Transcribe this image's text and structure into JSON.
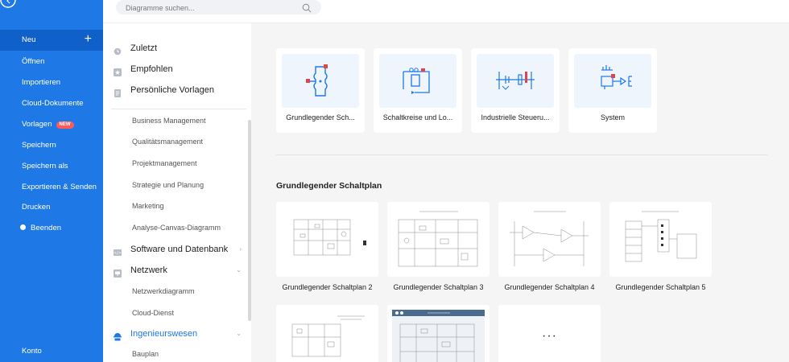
{
  "nav": {
    "items": [
      {
        "label": "Neu"
      },
      {
        "label": "Öffnen"
      },
      {
        "label": "Importieren"
      },
      {
        "label": "Cloud-Dokumente"
      },
      {
        "label": "Vorlagen",
        "badge": "NEW"
      },
      {
        "label": "Speichern"
      },
      {
        "label": "Speichern als"
      },
      {
        "label": "Exportieren & Senden"
      },
      {
        "label": "Drucken"
      },
      {
        "label": "Beenden"
      }
    ],
    "account": "Konto",
    "plus": "+"
  },
  "search": {
    "placeholder": "Diagramme suchen..."
  },
  "categories": {
    "recent": "Zuletzt",
    "recommended": "Empfohlen",
    "personal": "Persönliche Vorlagen",
    "subs": [
      "Business Management",
      "Qualitätsmanagement",
      "Projektmanagement",
      "Strategie und Planung",
      "Marketing",
      "Analyse-Canvas-Diagramm"
    ],
    "software": "Software und Datenbank",
    "network": "Netzwerk",
    "network_subs": [
      "Netzwerkdiagramm",
      "Cloud-Dienst"
    ],
    "engineering": "Ingenieurswesen",
    "engineering_subs": [
      "Bauplan"
    ]
  },
  "main": {
    "cat_cards": [
      {
        "label": "Grundlegender Sch..."
      },
      {
        "label": "Schaltkreise und Lo..."
      },
      {
        "label": "Industrielle Steueru..."
      },
      {
        "label": "System"
      }
    ],
    "section_title": "Grundlegender Schaltplan",
    "templates": [
      {
        "label": "Grundlegender Schaltplan 2"
      },
      {
        "label": "Grundlegender Schaltplan 3"
      },
      {
        "label": "Grundlegender Schaltplan 4"
      },
      {
        "label": "Grundlegender Schaltplan 5"
      }
    ],
    "more": "···"
  },
  "colors": {
    "accent": "#1e78e6",
    "badge": "#ff5a5a"
  }
}
